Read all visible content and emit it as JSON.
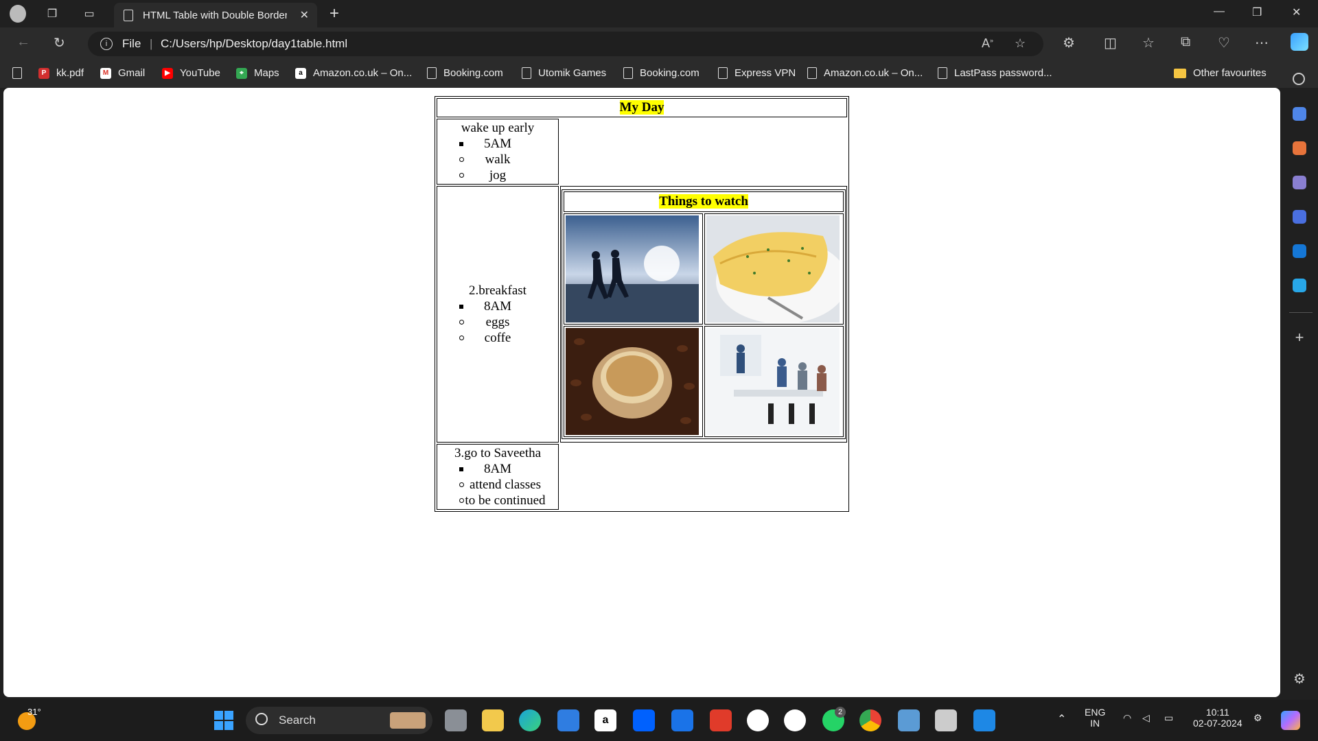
{
  "browser": {
    "tab_title": "HTML Table with Double Border",
    "address_scheme": "File",
    "url": "C:/Users/hp/Desktop/day1table.html"
  },
  "favorites": [
    "kk.pdf",
    "Gmail",
    "YouTube",
    "Maps",
    "Amazon.co.uk – On...",
    "Booking.com",
    "Utomik Games",
    "Booking.com",
    "Express VPN",
    "Amazon.co.uk – On...",
    "LastPass password...",
    "Other favourites"
  ],
  "page": {
    "heading": "My Day",
    "row1": {
      "title": "wake up early",
      "time": "5AM",
      "items": [
        "walk",
        "jog"
      ]
    },
    "row2": {
      "title": "2.breakfast",
      "time": "8AM",
      "items": [
        "eggs",
        "coffe"
      ]
    },
    "watch": {
      "heading": "Things to watch",
      "images": [
        "runners-at-beach-image",
        "omelette-image",
        "coffee-cup-image",
        "office-meeting-image"
      ]
    },
    "row3": {
      "title": "3.go to Saveetha",
      "time": "8AM",
      "items": [
        "attend classes",
        "to be continued"
      ]
    }
  },
  "taskbar": {
    "weather": "31°",
    "search_label": "Search",
    "language": "ENG",
    "region": "IN",
    "time": "10:11",
    "date": "02-07-2024",
    "whatsapp_badge": "2"
  }
}
